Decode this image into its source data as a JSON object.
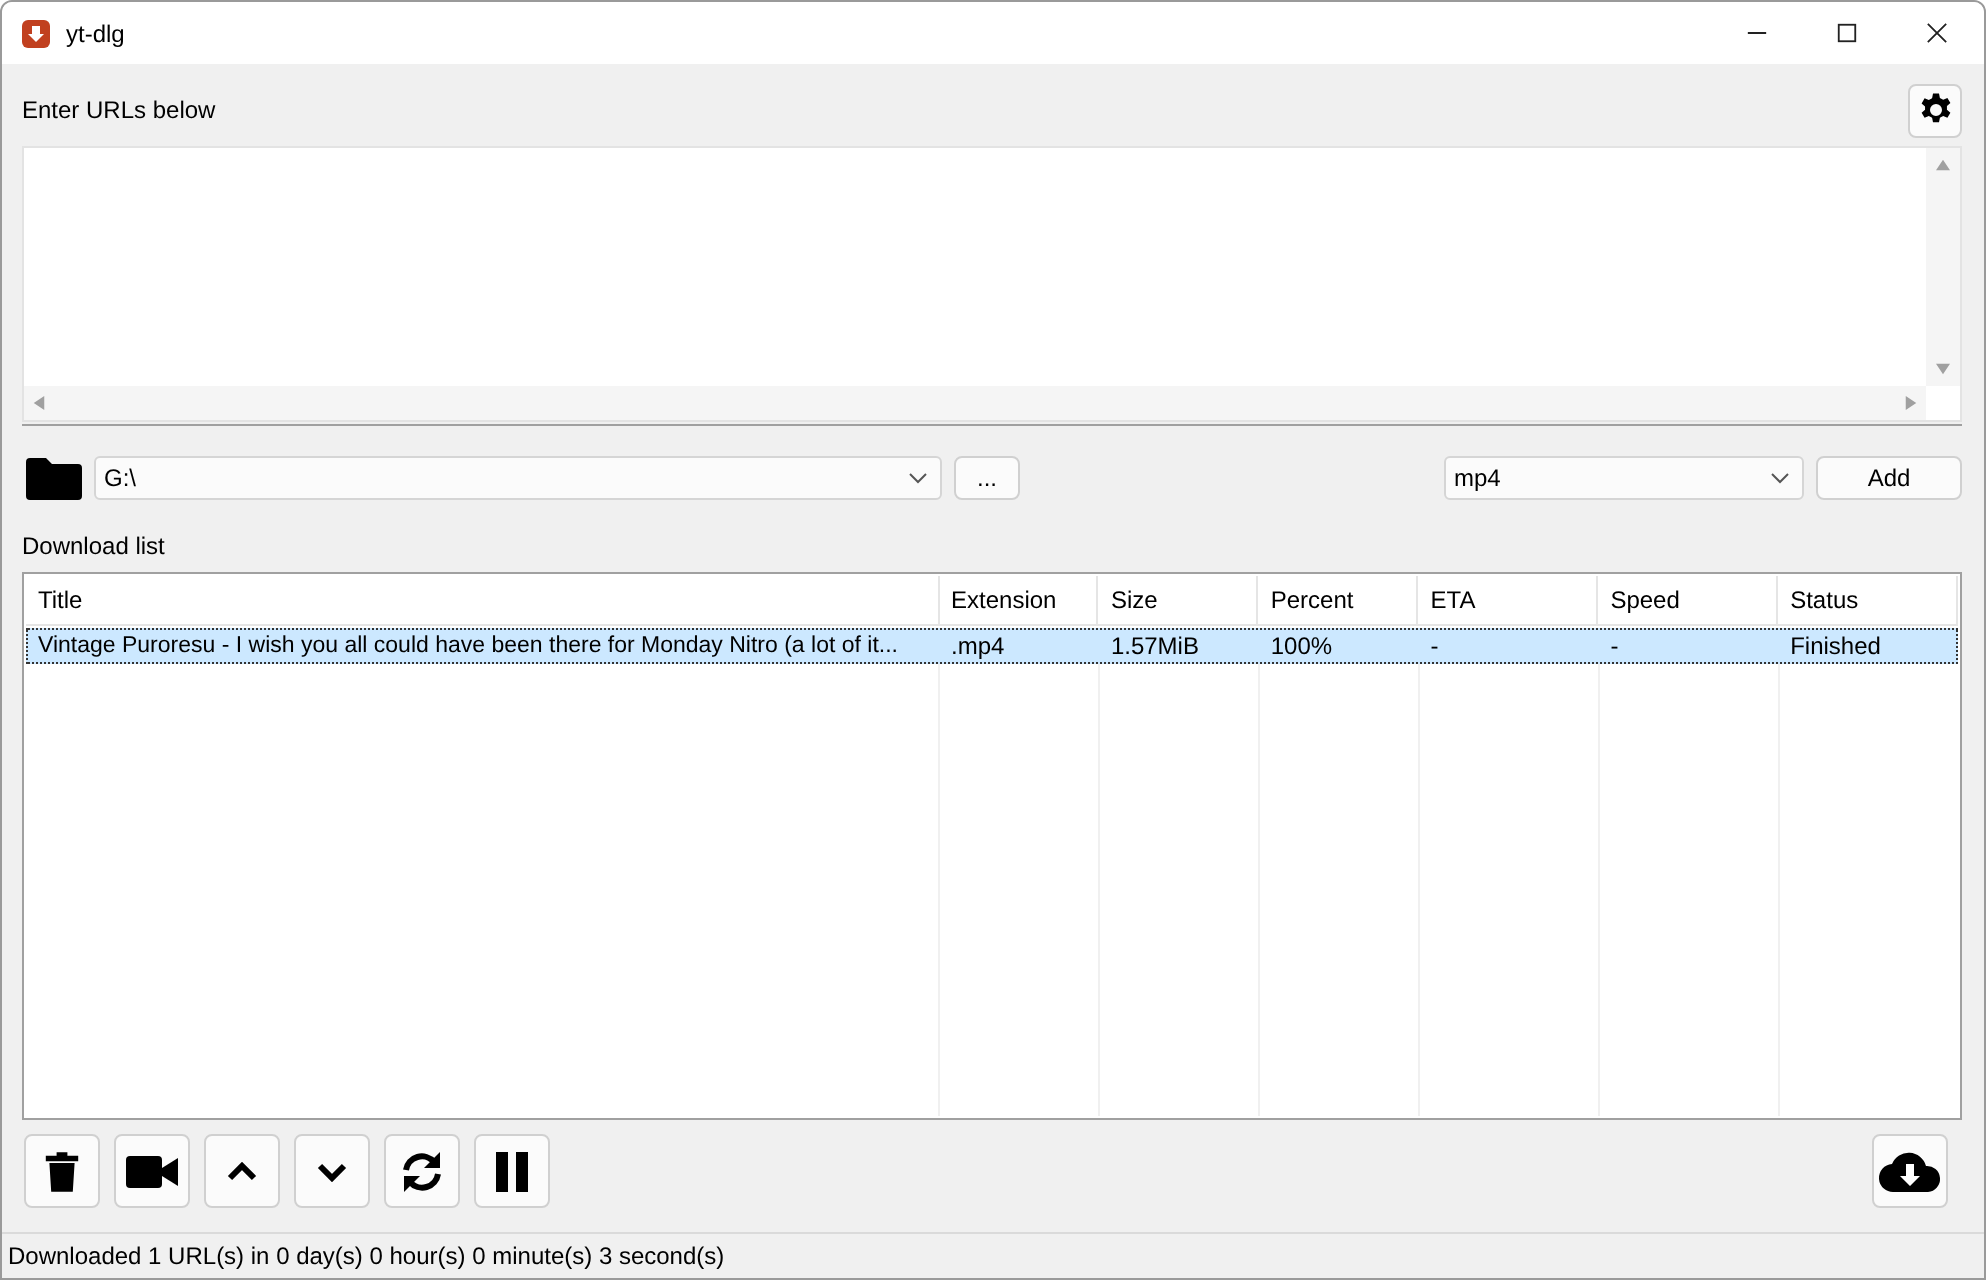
{
  "window": {
    "title": "yt-dlg"
  },
  "url_label": "Enter URLs below",
  "directory": {
    "value": "G:\\"
  },
  "browse_button": "...",
  "format": {
    "value": "mp4"
  },
  "add_button": "Add",
  "list_label": "Download list",
  "table": {
    "columns": [
      "Title",
      "Extension",
      "Size",
      "Percent",
      "ETA",
      "Speed",
      "Status"
    ],
    "rows": [
      {
        "selected": true,
        "cells": [
          "Vintage Puroresu - I wish you all could have been there for Monday Nitro (a lot of it...",
          ".mp4",
          "1.57MiB",
          "100%",
          "-",
          "-",
          "Finished"
        ]
      }
    ]
  },
  "status_bar": "Downloaded 1 URL(s) in 0 day(s) 0 hour(s) 0 minute(s) 3 second(s)"
}
